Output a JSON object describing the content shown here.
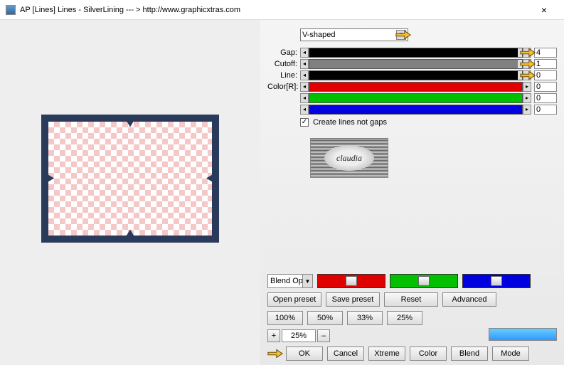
{
  "window": {
    "title": "AP [Lines]  Lines - SilverLining    --- >  http://www.graphicxtras.com"
  },
  "shape": {
    "selected": "V-shaped"
  },
  "sliders": {
    "gap": {
      "label": "Gap:",
      "value": "4",
      "fill": "#000000",
      "pct": 98
    },
    "cutoff": {
      "label": "Cutoff:",
      "value": "1",
      "fill": "#808080",
      "pct": 98
    },
    "line": {
      "label": "Line:",
      "value": "0",
      "fill": "#000000",
      "pct": 98
    },
    "r": {
      "label": "Color[R]:",
      "value": "0",
      "fill": "#e00000",
      "pct": 100
    },
    "g": {
      "label": "",
      "value": "0",
      "fill": "#00c000",
      "pct": 100
    },
    "b": {
      "label": "",
      "value": "0",
      "fill": "#0000e0",
      "pct": 100
    }
  },
  "checkbox": {
    "label": "Create lines not gaps",
    "checked": true
  },
  "logo": {
    "text": "claudia"
  },
  "blend_select": {
    "label": "Blend Optio"
  },
  "blend_sliders": {
    "r": "#e00000",
    "g": "#00c000",
    "b": "#0000e0"
  },
  "buttons": {
    "open_preset": "Open preset",
    "save_preset": "Save preset",
    "reset": "Reset",
    "advanced": "Advanced",
    "p100": "100%",
    "p50": "50%",
    "p33": "33%",
    "p25": "25%",
    "zoom": "25%",
    "ok": "OK",
    "cancel": "Cancel",
    "xtreme": "Xtreme",
    "color": "Color",
    "blend": "Blend",
    "mode": "Mode"
  }
}
